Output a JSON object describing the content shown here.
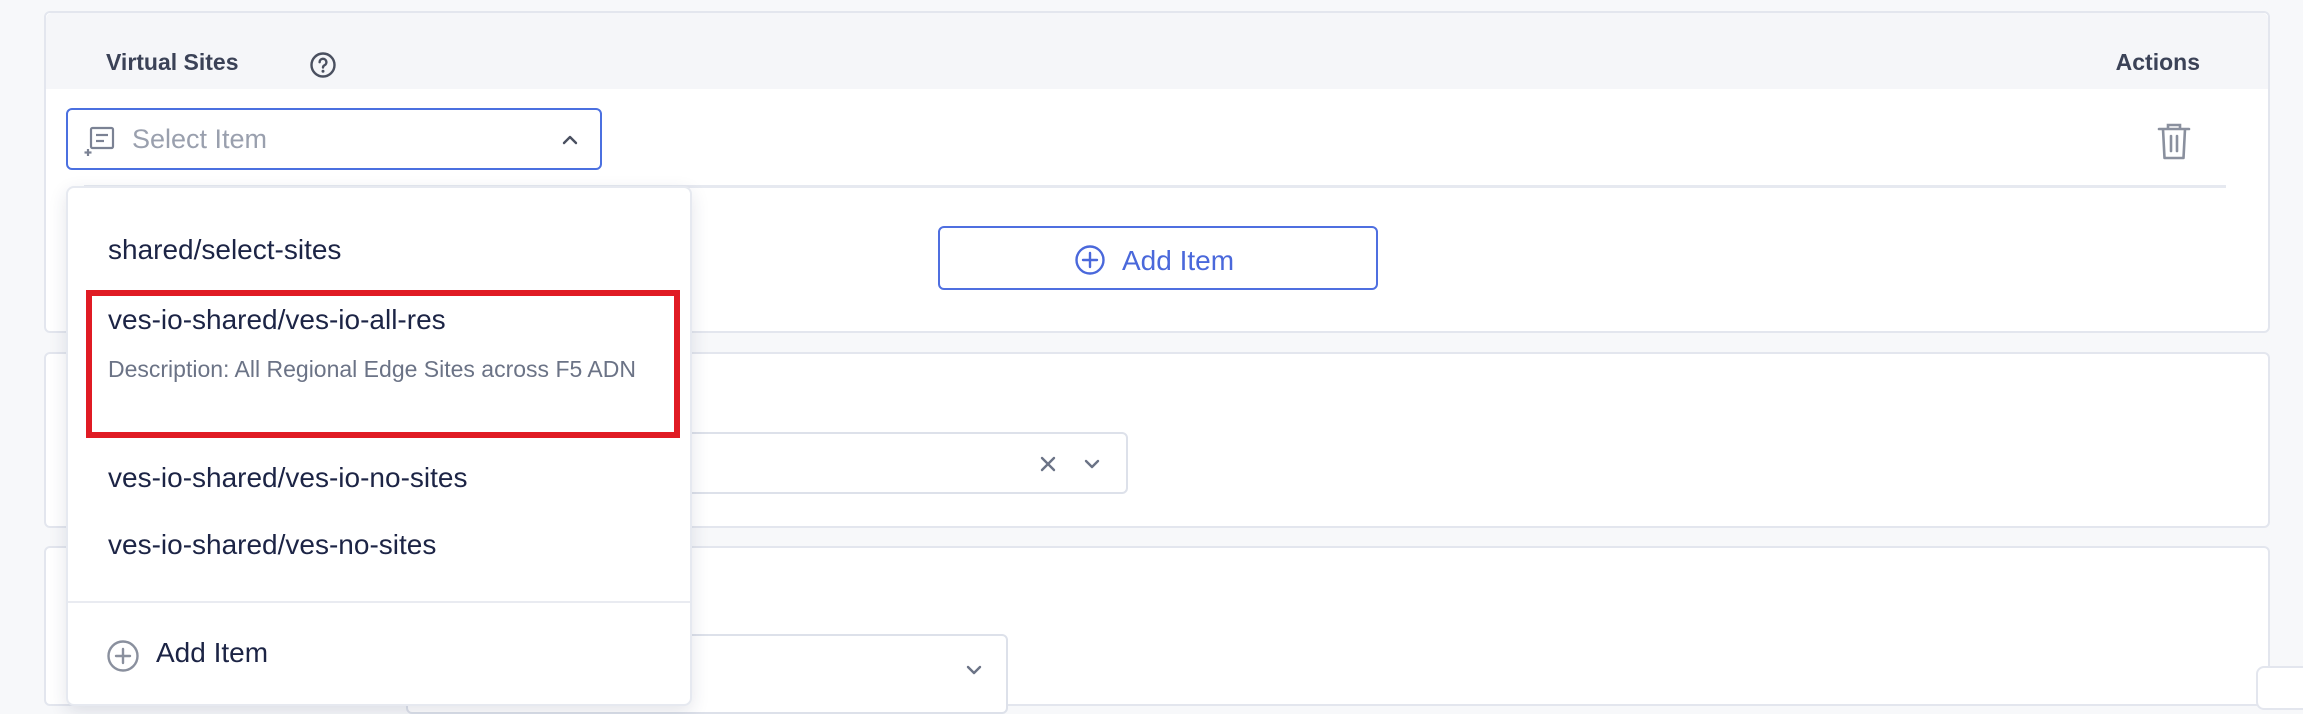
{
  "virtual_sites": {
    "title": "Virtual Sites",
    "actions_label": "Actions",
    "select": {
      "placeholder": "Select Item"
    },
    "add_item_button": "Add Item"
  },
  "dropdown": {
    "options": [
      {
        "label": "shared/select-sites"
      },
      {
        "label": "ves-io-shared/ves-io-all-res",
        "description": "Description: All Regional Edge Sites across F5 ADN"
      },
      {
        "label": "ves-io-shared/ves-io-no-sites"
      },
      {
        "label": "ves-io-shared/ves-no-sites"
      }
    ],
    "add_item_label": "Add Item"
  },
  "colors": {
    "accent": "#4a68db",
    "highlight": "#e01b24",
    "text": "#1c2445",
    "muted": "#6b7386"
  },
  "icons": [
    "help-icon",
    "list-select-icon",
    "chevron-up-icon",
    "trash-icon",
    "plus-circle-icon",
    "clear-x-icon",
    "chevron-down-icon"
  ]
}
